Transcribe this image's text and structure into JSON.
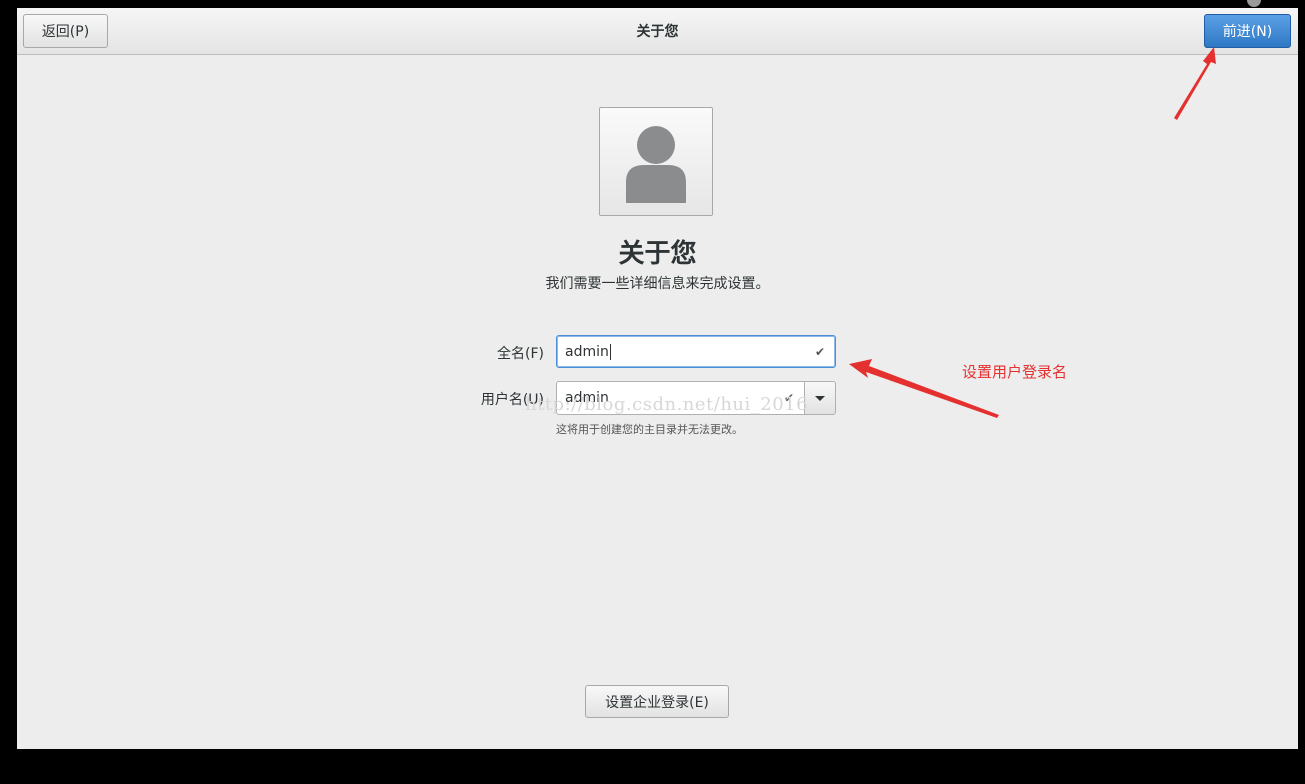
{
  "header": {
    "back_label": "返回(P)",
    "title": "关于您",
    "next_label": "前进(N)"
  },
  "main": {
    "heading": "关于您",
    "subheading": "我们需要一些详细信息来完成设置。",
    "fullname": {
      "label": "全名(F)",
      "value": "admin"
    },
    "username": {
      "label": "用户名(U)",
      "value": "admin"
    },
    "hint": "这将用于创建您的主目录并无法更改。",
    "enterprise_login_label": "设置企业登录(E)"
  },
  "watermark": "http://blog.csdn.net/hui_2016",
  "annotation": {
    "text": "设置用户登录名",
    "color": "#e53030"
  },
  "colors": {
    "accent": "#3b85d6",
    "annotation": "#e53030"
  },
  "icons": [
    "avatar-icon",
    "check-icon",
    "chevron-down-icon"
  ]
}
